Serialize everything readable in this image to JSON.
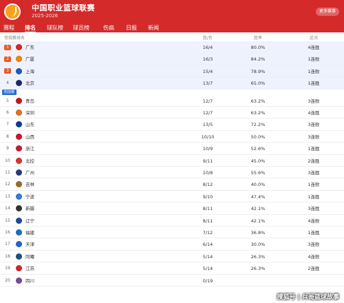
{
  "header": {
    "title": "中国职业篮球联赛",
    "subtitle": "2025-2026",
    "more_label": "更多赛事"
  },
  "tabs": [
    {
      "label": "赛程",
      "active": false
    },
    {
      "label": "排名",
      "active": true
    },
    {
      "label": "球队榜",
      "active": false
    },
    {
      "label": "球员榜",
      "active": false
    },
    {
      "label": "伤病",
      "active": false
    },
    {
      "label": "日报",
      "active": false
    },
    {
      "label": "新闻",
      "active": false
    }
  ],
  "table": {
    "section_label": "常规赛排名",
    "columns": {
      "wl": "胜/负",
      "pct": "胜率",
      "streak": "近况"
    },
    "playin_tag": "附加赛",
    "rows": [
      {
        "rank": "1",
        "team": "广东",
        "wl": "16/4",
        "pct": "80.0%",
        "streak": "4连胜",
        "color": "#e2231a"
      },
      {
        "rank": "2",
        "team": "广厦",
        "wl": "16/3",
        "pct": "84.2%",
        "streak": "1连败",
        "color": "#f08a00"
      },
      {
        "rank": "3",
        "team": "上海",
        "wl": "15/4",
        "pct": "78.9%",
        "streak": "1连败",
        "color": "#1d5bbf"
      },
      {
        "rank": "4",
        "team": "北京",
        "wl": "13/7",
        "pct": "65.0%",
        "streak": "1连胜",
        "color": "#1a2a6c"
      },
      {
        "rank": "5",
        "team": "青岛",
        "wl": "12/7",
        "pct": "63.2%",
        "streak": "3连败",
        "color": "#c8161d"
      },
      {
        "rank": "6",
        "team": "深圳",
        "wl": "12/7",
        "pct": "63.2%",
        "streak": "4连胜",
        "color": "#e37222"
      },
      {
        "rank": "7",
        "team": "山东",
        "wl": "13/5",
        "pct": "72.2%",
        "streak": "3连败",
        "color": "#0b3d91"
      },
      {
        "rank": "8",
        "team": "山西",
        "wl": "10/10",
        "pct": "50.0%",
        "streak": "3连败",
        "color": "#d0142c"
      },
      {
        "rank": "9",
        "team": "浙江",
        "wl": "10/9",
        "pct": "52.6%",
        "streak": "1连胜",
        "color": "#c21f39"
      },
      {
        "rank": "10",
        "team": "北控",
        "wl": "9/11",
        "pct": "45.0%",
        "streak": "2连胜",
        "color": "#e0312b"
      },
      {
        "rank": "11",
        "team": "广州",
        "wl": "10/8",
        "pct": "55.6%",
        "streak": "3连胜",
        "color": "#253b80"
      },
      {
        "rank": "12",
        "team": "吉林",
        "wl": "8/12",
        "pct": "40.0%",
        "streak": "1连败",
        "color": "#9a6a2f"
      },
      {
        "rank": "13",
        "team": "宁波",
        "wl": "9/10",
        "pct": "47.4%",
        "streak": "1连胜",
        "color": "#2f7de1"
      },
      {
        "rank": "14",
        "team": "新疆",
        "wl": "8/11",
        "pct": "42.1%",
        "streak": "3连胜",
        "color": "#333333"
      },
      {
        "rank": "15",
        "team": "辽宁",
        "wl": "8/11",
        "pct": "42.1%",
        "streak": "4连败",
        "color": "#1c4aa0"
      },
      {
        "rank": "16",
        "team": "福建",
        "wl": "7/12",
        "pct": "36.8%",
        "streak": "1连胜",
        "color": "#1b6fbf"
      },
      {
        "rank": "17",
        "team": "天津",
        "wl": "6/14",
        "pct": "30.0%",
        "streak": "3连败",
        "color": "#2266cc"
      },
      {
        "rank": "18",
        "team": "同曦",
        "wl": "5/14",
        "pct": "26.3%",
        "streak": "4连败",
        "color": "#1f4e8c"
      },
      {
        "rank": "19",
        "team": "江苏",
        "wl": "5/14",
        "pct": "26.3%",
        "streak": "2连胜",
        "color": "#d7262e"
      },
      {
        "rank": "20",
        "team": "四川",
        "wl": "0/19",
        "pct": "",
        "streak": "",
        "color": "#7a4b9a"
      }
    ]
  },
  "colors": {
    "brand_red": "#d42a2a",
    "top4_badge": "#e85a2a",
    "playin_tag": "#2c6fd1",
    "playoff_bg": "#eef2ff"
  },
  "watermark": "搜狐号 | 兵哥篮球故事"
}
